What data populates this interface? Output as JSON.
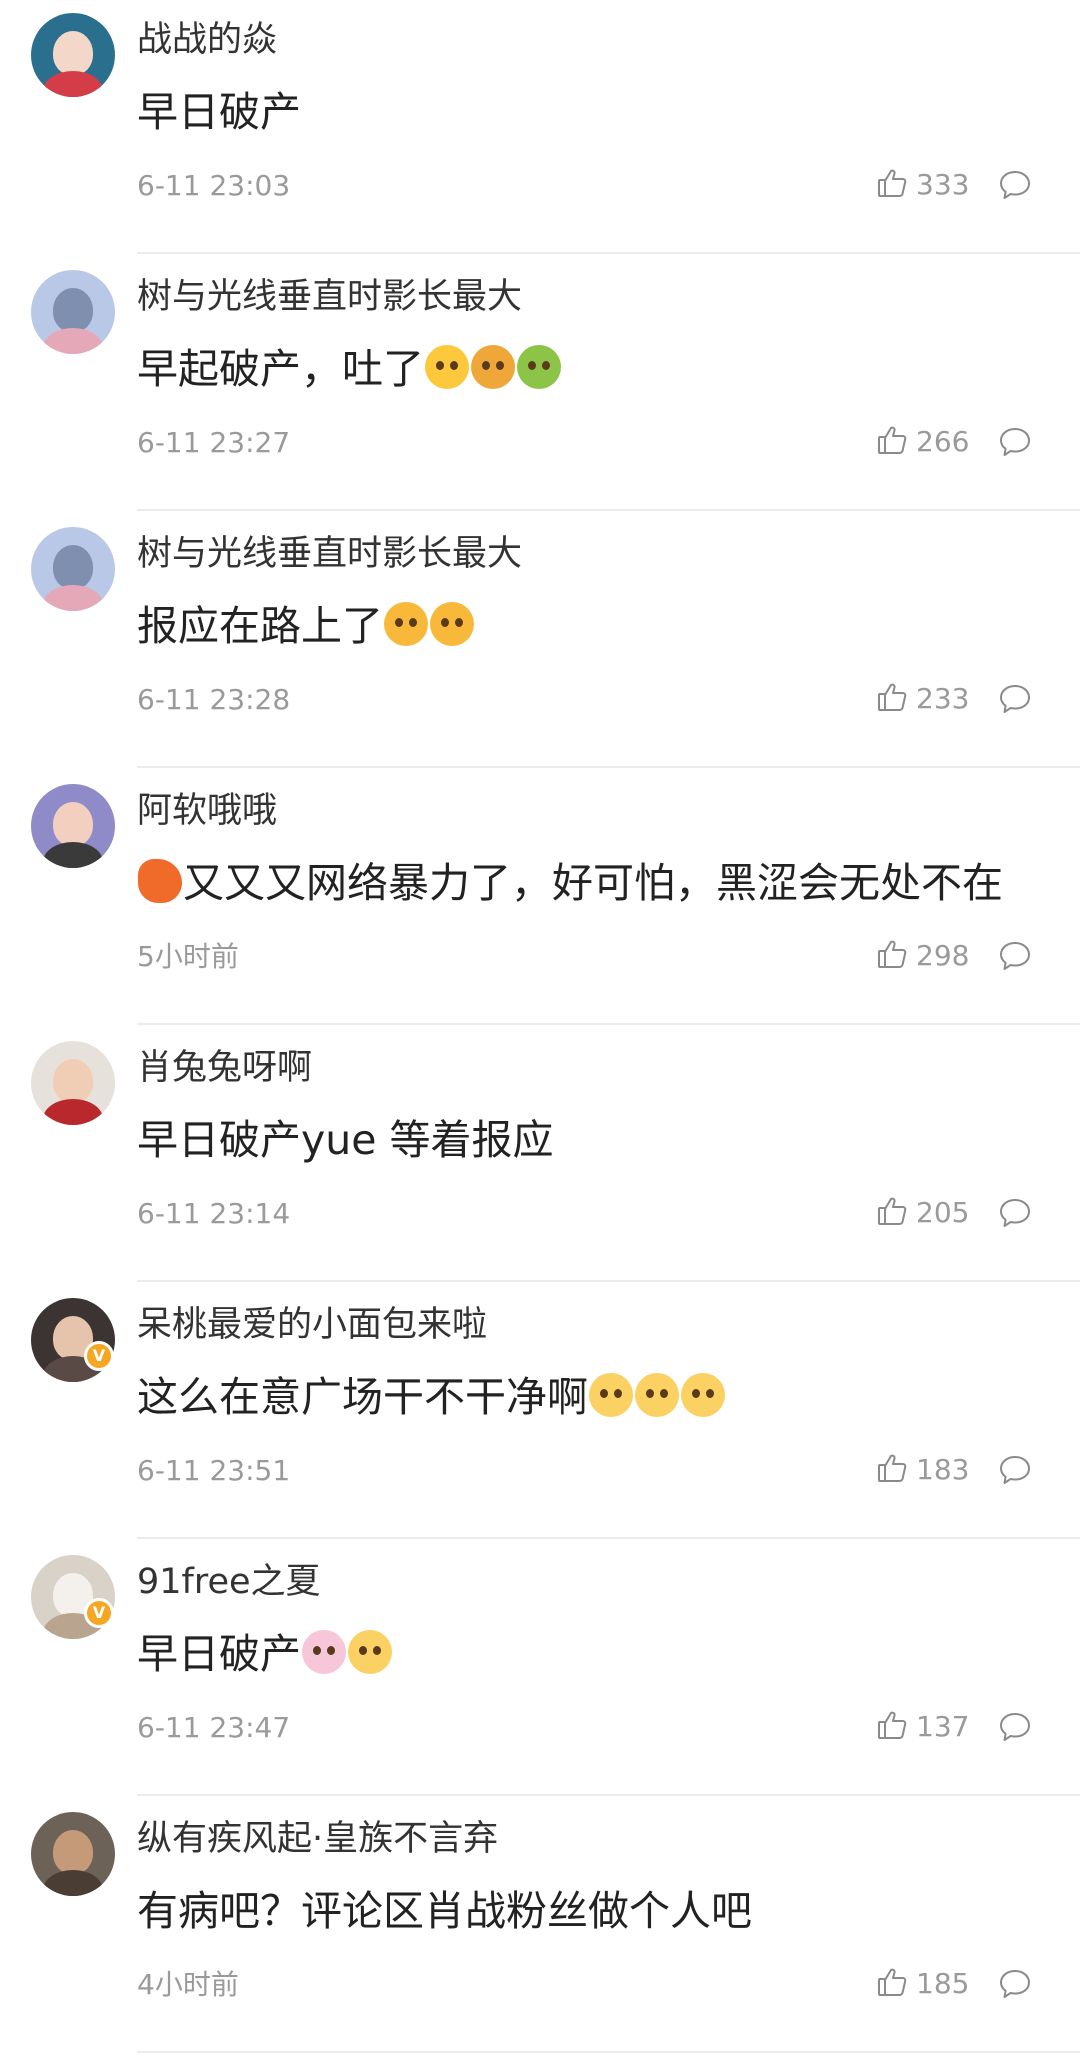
{
  "comments": [
    {
      "username": "战战的焱",
      "text": "早日破产",
      "emojis": [],
      "time": "6-11 23:03",
      "likes": "333",
      "verified": false,
      "avatar_colors": {
        "bg": "#2b6f8f",
        "face": "#f3d7c8",
        "body": "#d43c48"
      }
    },
    {
      "username": "树与光线垂直时影长最大",
      "text": "早起破产，吐了",
      "emojis": [
        "pleading-face-emoji",
        "exploding-head-emoji",
        "nauseated-face-emoji"
      ],
      "time": "6-11 23:27",
      "likes": "266",
      "verified": false,
      "avatar_colors": {
        "bg": "#b9c8e6",
        "face": "#7f8fb0",
        "body": "#e4a8b8"
      }
    },
    {
      "username": "树与光线垂直时影长最大",
      "text": "报应在路上了",
      "emojis": [
        "crying-face-emoji",
        "crying-face-emoji"
      ],
      "time": "6-11 23:28",
      "likes": "233",
      "verified": false,
      "avatar_colors": {
        "bg": "#b9c8e6",
        "face": "#7f8fb0",
        "body": "#e4a8b8"
      }
    },
    {
      "username": "阿软哦哦",
      "text": "又又又网络暴力了，好可怕，黑涩会无处不在",
      "emojis": [
        "shrimp-emoji"
      ],
      "emoji_position": "before",
      "time": "5小时前",
      "likes": "298",
      "verified": false,
      "avatar_colors": {
        "bg": "#8f8ac8",
        "face": "#f2cfbf",
        "body": "#3a3a3a"
      }
    },
    {
      "username": "肖兔兔呀啊",
      "text": "早日破产yue 等着报应",
      "emojis": [],
      "time": "6-11 23:14",
      "likes": "205",
      "verified": false,
      "avatar_colors": {
        "bg": "#e7e1dc",
        "face": "#f0cdb5",
        "body": "#b8282c"
      }
    },
    {
      "username": "呆桃最爱的小面包来啦",
      "text": "这么在意广场干不干净啊",
      "emojis": [
        "pleading-hands-emoji",
        "pleading-hands-emoji",
        "pleading-hands-emoji"
      ],
      "time": "6-11 23:51",
      "likes": "183",
      "verified": true,
      "avatar_colors": {
        "bg": "#3b3432",
        "face": "#e6c3ab",
        "body": "#5a4a46"
      }
    },
    {
      "username": "91free之夏",
      "text": "早日破产",
      "emojis": [
        "bunny-emoji",
        "pleading-hands-emoji"
      ],
      "time": "6-11 23:47",
      "likes": "137",
      "verified": true,
      "avatar_colors": {
        "bg": "#d8d2c8",
        "face": "#f4f0ec",
        "body": "#b9a58f"
      }
    },
    {
      "username": "纵有疾风起·皇族不言弃",
      "text": "有病吧？评论区肖战粉丝做个人吧",
      "emojis": [],
      "time": "4小时前",
      "likes": "185",
      "verified": false,
      "avatar_colors": {
        "bg": "#6d6257",
        "face": "#c59a79",
        "body": "#4a3d33"
      }
    }
  ],
  "icons": {
    "like": "thumbs-up-icon",
    "reply": "comment-bubble-icon",
    "verified": "verified-badge-icon"
  },
  "verified_badge_glyph": "V"
}
